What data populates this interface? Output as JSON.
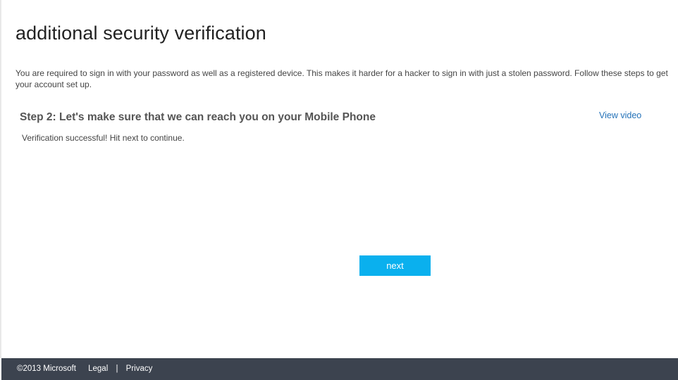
{
  "page": {
    "title": "additional security verification",
    "intro": "You are required to sign in with your password as well as a registered device. This makes it harder for a hacker to sign in with just a stolen password. Follow these steps to get your account set up."
  },
  "step": {
    "heading": "Step 2: Let's make sure that we can reach you on your Mobile Phone",
    "view_video_label": "View video",
    "status_message": "Verification successful! Hit next to continue."
  },
  "actions": {
    "next_label": "next"
  },
  "footer": {
    "copyright": "©2013 Microsoft",
    "legal_label": "Legal",
    "separator": "|",
    "privacy_label": "Privacy"
  },
  "colors": {
    "accent_button": "#0ab0ee",
    "link": "#2472b8",
    "footer_bg": "#3c434f"
  }
}
